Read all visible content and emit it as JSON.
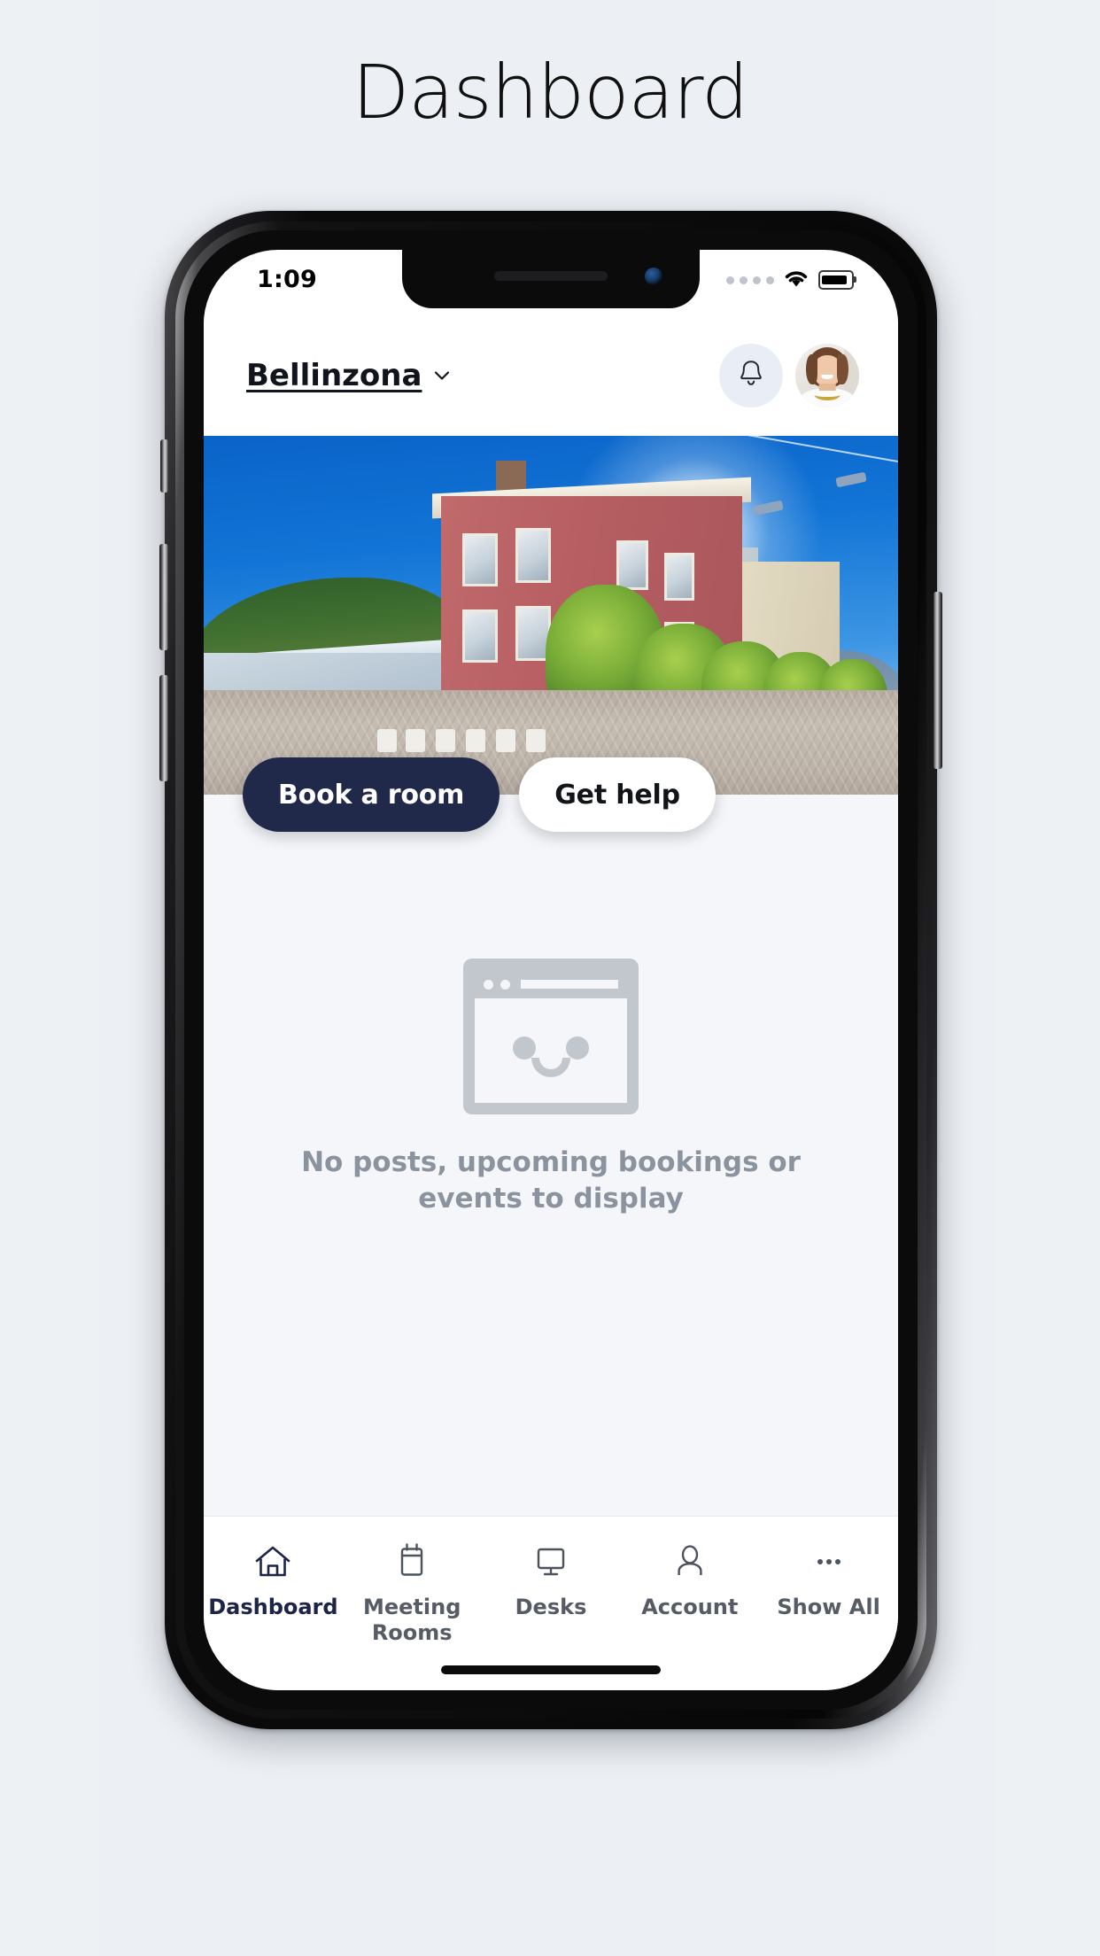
{
  "page": {
    "title": "Dashboard",
    "background_color": "#eceff3"
  },
  "status_bar": {
    "time": "1:09",
    "signal_icon": "signal-dots-icon",
    "wifi_icon": "wifi-icon",
    "battery_icon": "battery-full-icon"
  },
  "header": {
    "location": "Bellinzona",
    "location_chevron": "chevron-down-icon",
    "notifications_icon": "bell-icon",
    "avatar": "user-avatar"
  },
  "hero": {
    "alt": "Bellinzona town square with red building, trees and cobblestone plaza"
  },
  "actions": {
    "primary_label": "Book a room",
    "secondary_label": "Get help",
    "primary_color": "#21294a",
    "secondary_color": "#ffffff"
  },
  "empty_state": {
    "illustration": "browser-window-smiley-icon",
    "message": "No posts, upcoming bookings or events to display",
    "text_color": "#8b939e"
  },
  "tabbar": {
    "active_color": "#1c2448",
    "inactive_color": "#555c66",
    "items": [
      {
        "label": "Dashboard",
        "icon": "home-icon",
        "active": true
      },
      {
        "label": "Meeting Rooms",
        "icon": "calendar-icon",
        "active": false
      },
      {
        "label": "Desks",
        "icon": "monitor-icon",
        "active": false
      },
      {
        "label": "Account",
        "icon": "person-icon",
        "active": false
      },
      {
        "label": "Show All",
        "icon": "ellipsis-icon",
        "active": false
      }
    ]
  }
}
